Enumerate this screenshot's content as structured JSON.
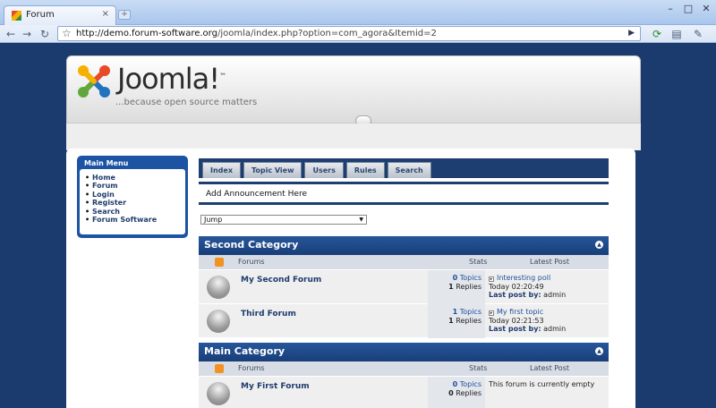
{
  "browser": {
    "tab_title": "Forum",
    "tab_close": "×",
    "new_tab": "+",
    "url_domain": "http://demo.forum-software.org",
    "url_path": "/joomla/index.php?option=com_agora&Itemid=2"
  },
  "header": {
    "logo_text": "Joomla!",
    "logo_tm": "™",
    "tagline": "...because open source matters"
  },
  "main_menu": {
    "title": "Main Menu",
    "items": [
      "Home",
      "Forum",
      "Login",
      "Register",
      "Search",
      "Forum Software"
    ]
  },
  "forum_tabs": [
    "Index",
    "Topic View",
    "Users",
    "Rules",
    "Search"
  ],
  "announcement": "Add Announcement Here",
  "jump": {
    "selected": "Jump"
  },
  "columns": {
    "forums": "Forums",
    "stats": "Stats",
    "latest": "Latest Post"
  },
  "categories": [
    {
      "name": "Second Category",
      "forums": [
        {
          "name": "My Second Forum",
          "topics_num": "0",
          "topics_label": "Topics",
          "replies_num": "1",
          "replies_label": "Replies",
          "latest_title": "Interesting poll",
          "latest_time": "Today 02:20:49",
          "latest_by_label": "Last post by:",
          "latest_by": "admin"
        },
        {
          "name": "Third Forum",
          "topics_num": "1",
          "topics_label": "Topics",
          "replies_num": "1",
          "replies_label": "Replies",
          "latest_title": "My first topic",
          "latest_time": "Today 02:21:53",
          "latest_by_label": "Last post by:",
          "latest_by": "admin"
        }
      ]
    },
    {
      "name": "Main Category",
      "forums": [
        {
          "name": "My First Forum",
          "topics_num": "0",
          "topics_label": "Topics",
          "replies_num": "0",
          "replies_label": "Replies",
          "latest_empty": "This forum is currently empty"
        }
      ]
    }
  ],
  "colors": {
    "accent": "#1c3e70",
    "page_bg": "#1b3a6e",
    "menu_blue": "#1c54a3",
    "rss": "#f29223"
  }
}
